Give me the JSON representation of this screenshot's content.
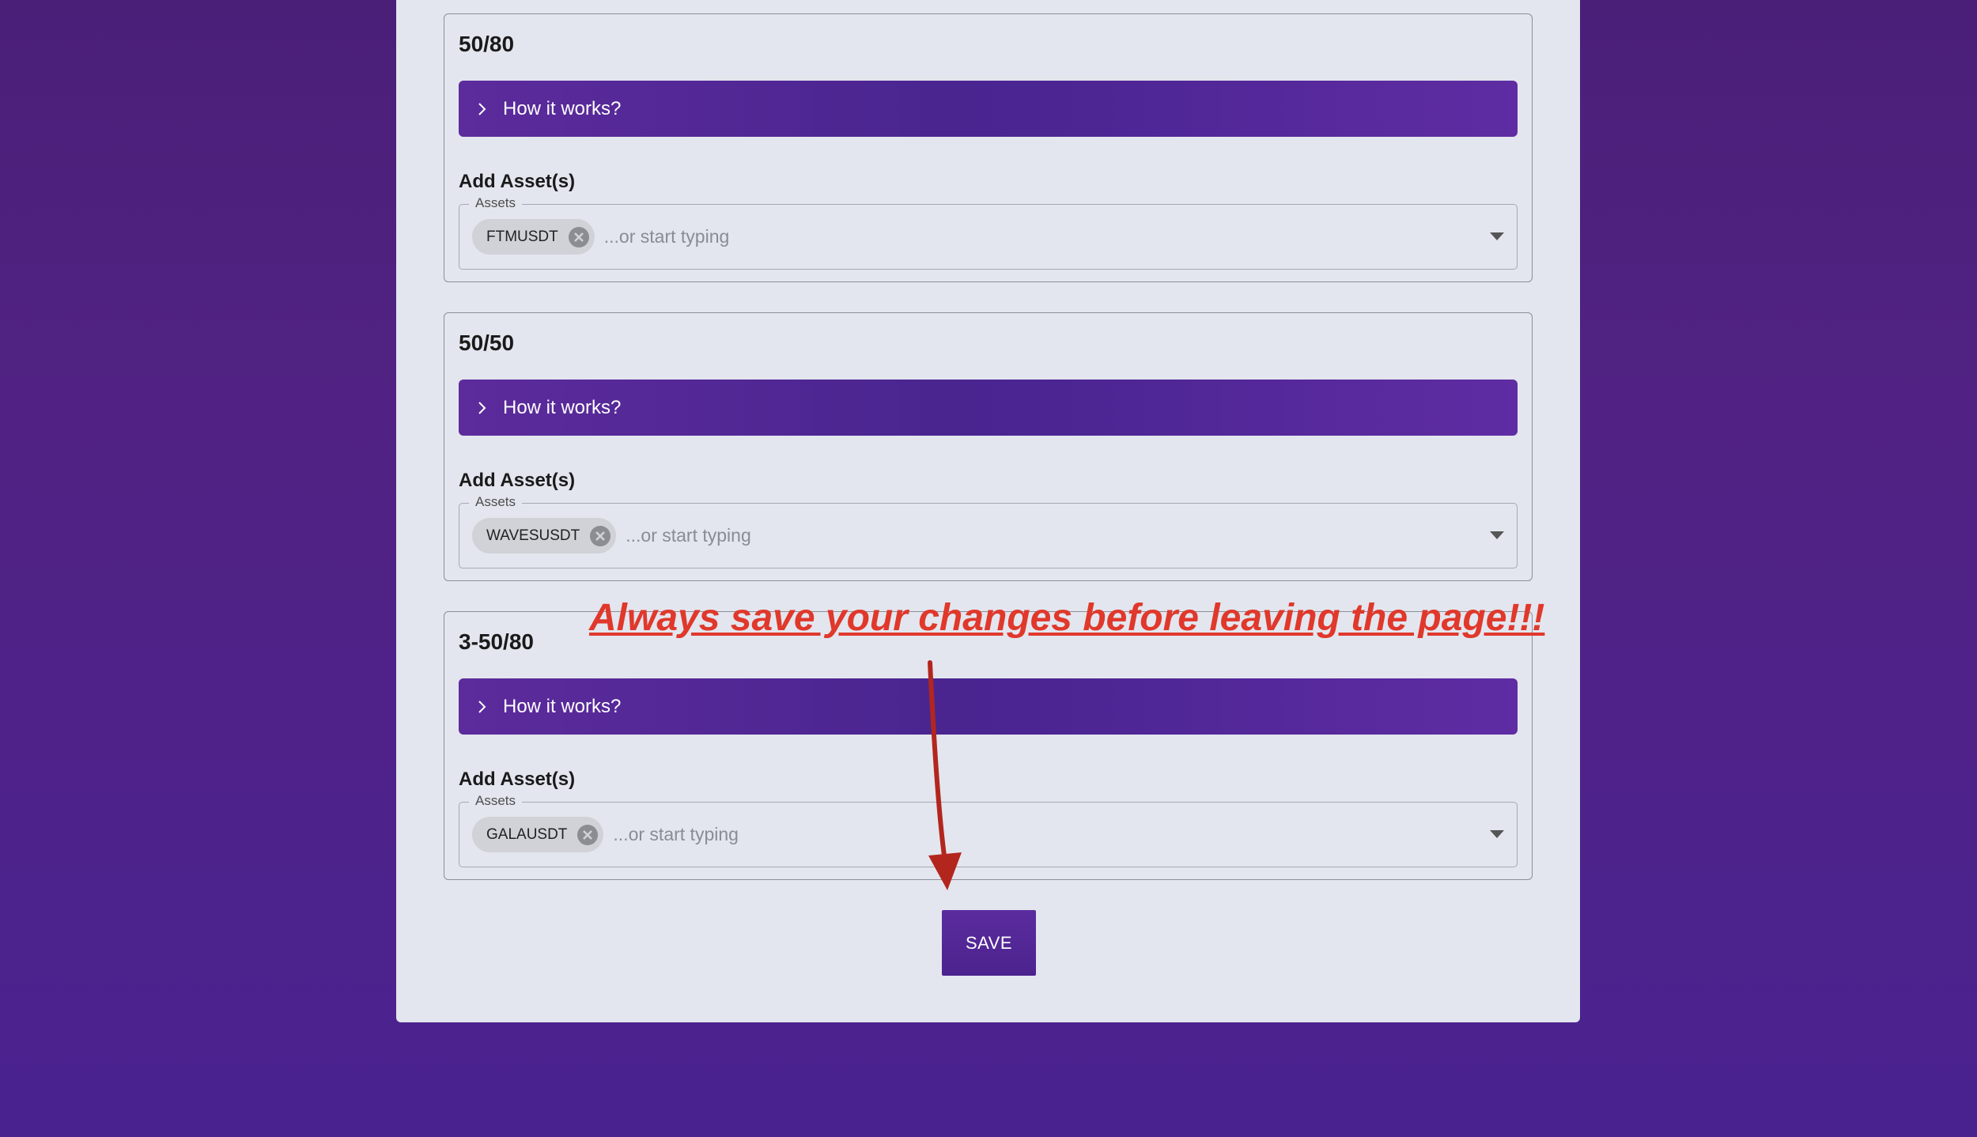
{
  "strategies": [
    {
      "title": "50/80",
      "how_label": "How it works?",
      "add_label": "Add Asset(s)",
      "field_legend": "Assets",
      "chip": "FTMUSDT",
      "placeholder": "...or start typing"
    },
    {
      "title": "50/50",
      "how_label": "How it works?",
      "add_label": "Add Asset(s)",
      "field_legend": "Assets",
      "chip": "WAVESUSDT",
      "placeholder": "...or start typing"
    },
    {
      "title": "3-50/80",
      "how_label": "How it works?",
      "add_label": "Add Asset(s)",
      "field_legend": "Assets",
      "chip": "GALAUSDT",
      "placeholder": "...or start typing"
    }
  ],
  "save_label": "SAVE",
  "annotation": {
    "text": "Always save your changes before leaving the page!!!",
    "color": "#e0382b"
  },
  "colors": {
    "accent": "#4c238e",
    "background": "#4a2290"
  }
}
